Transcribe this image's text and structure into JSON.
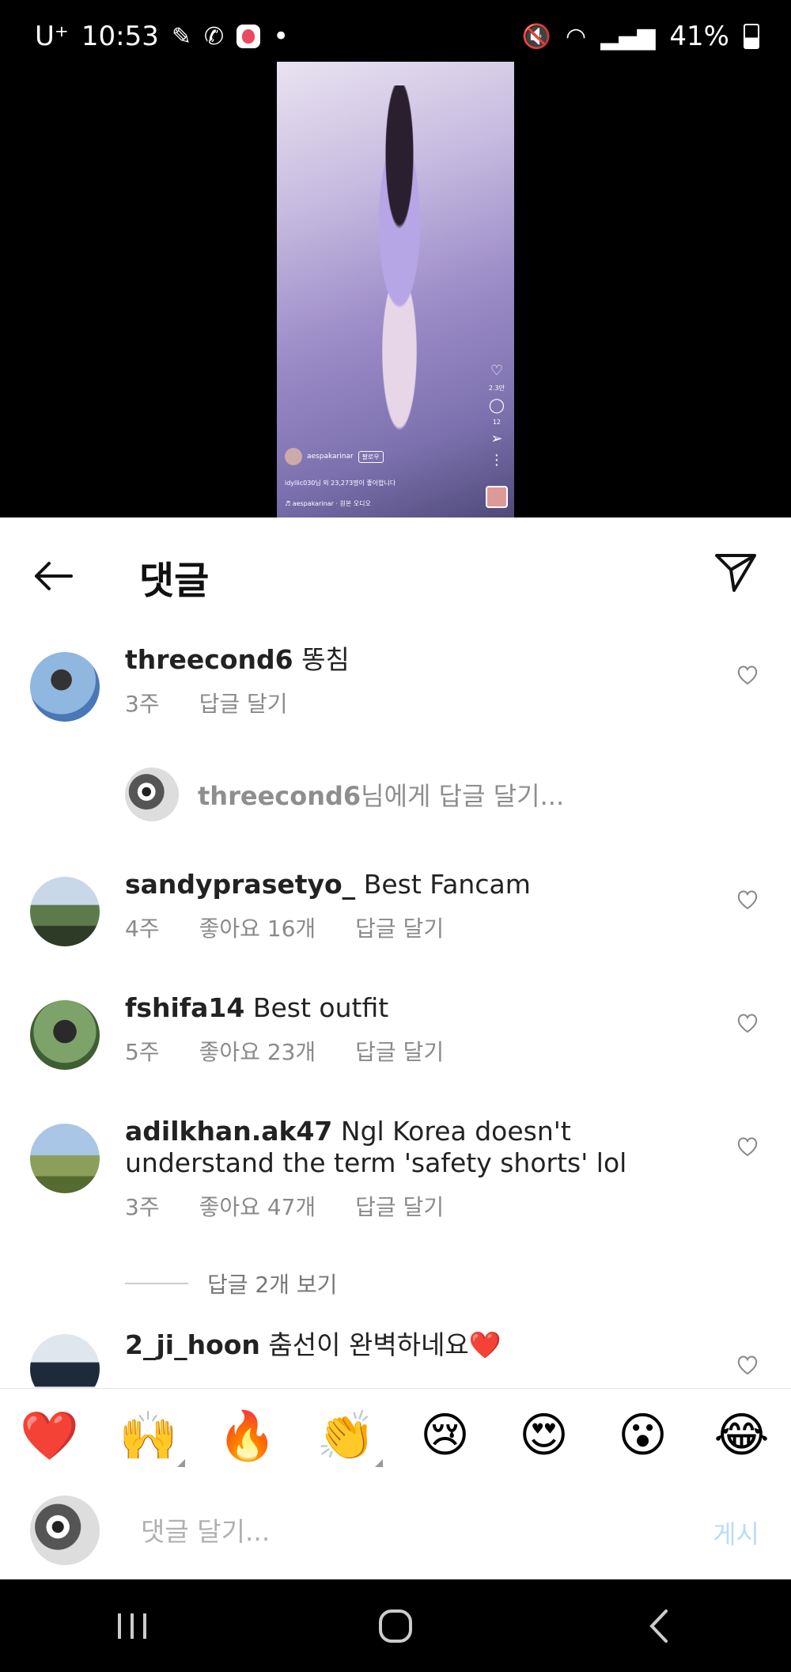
{
  "status": {
    "carrier": "U⁺",
    "time": "10:53",
    "battery": "41%"
  },
  "video": {
    "username": "aespakarinar",
    "follow_label": "팔로우",
    "likes_text": "idyllic030님 외 23,273명이 좋아합니다",
    "audio_text": "♬ aespakarinar · 원본 오디오",
    "like_count": "2.3만",
    "comment_count": "12"
  },
  "header": {
    "title": "댓글"
  },
  "comments": [
    {
      "user": "threecond6",
      "text": "똥침",
      "age": "3주",
      "likes": "",
      "reply": "답글 달기"
    },
    {
      "user": "sandyprasetyo_",
      "text": "Best Fancam",
      "age": "4주",
      "likes": "좋아요 16개",
      "reply": "답글 달기"
    },
    {
      "user": "fshifa14",
      "text": "Best outfit",
      "age": "5주",
      "likes": "좋아요 23개",
      "reply": "답글 달기"
    },
    {
      "user": "adilkhan.ak47",
      "text": "Ngl Korea doesn't understand the term 'safety shorts' lol",
      "age": "3주",
      "likes": "좋아요 47개",
      "reply": "답글 달기"
    },
    {
      "user": "2_ji_hoon",
      "text": "춤선이 완벽하네요❤️",
      "age": "",
      "likes": "",
      "reply": ""
    }
  ],
  "reply_prompt": {
    "user": "threecond6",
    "suffix": "님에게 답글 달기..."
  },
  "view_replies": "답글 2개 보기",
  "emojis": [
    "❤️",
    "🙌",
    "🔥",
    "👏",
    "😢",
    "😍",
    "😮",
    "😂"
  ],
  "input": {
    "placeholder": "댓글 달기...",
    "post_label": "게시"
  }
}
